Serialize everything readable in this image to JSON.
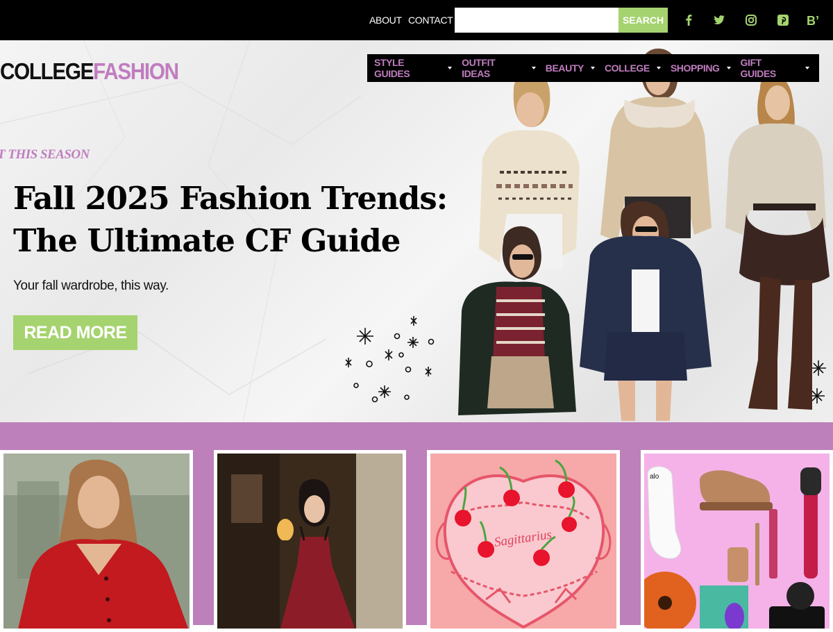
{
  "topbar": {
    "about_label": "ABOUT",
    "contact_label": "CONTACT",
    "search_placeholder": "",
    "search_button_label": "SEARCH",
    "social_icons": [
      "facebook-icon",
      "twitter-icon",
      "instagram-icon",
      "pinterest-icon",
      "bloglovin-icon"
    ],
    "bloglovin_glyph": "B’"
  },
  "logo": {
    "part1": "COLLEGE",
    "part2": "FASHION"
  },
  "nav": {
    "items": [
      {
        "label": "STYLE GUIDES"
      },
      {
        "label": "OUTFIT IDEAS"
      },
      {
        "label": "BEAUTY"
      },
      {
        "label": "COLLEGE"
      },
      {
        "label": "SHOPPING"
      },
      {
        "label": "GIFT GUIDES"
      }
    ]
  },
  "hero": {
    "eyebrow": "T THIS SEASON",
    "headline_line1": "Fall 2025 Fashion Trends:",
    "headline_line2": "The Ultimate CF Guide",
    "subhead": "Your fall wardrobe, this way.",
    "read_more_label": "READ MORE"
  },
  "cards": {
    "card3_cake_text": "Sagittarius"
  },
  "colors": {
    "brand_purple": "#c07dbf",
    "band_purple": "#bd80bb",
    "accent_green": "#a5d36f",
    "topbar_black": "#000000"
  }
}
